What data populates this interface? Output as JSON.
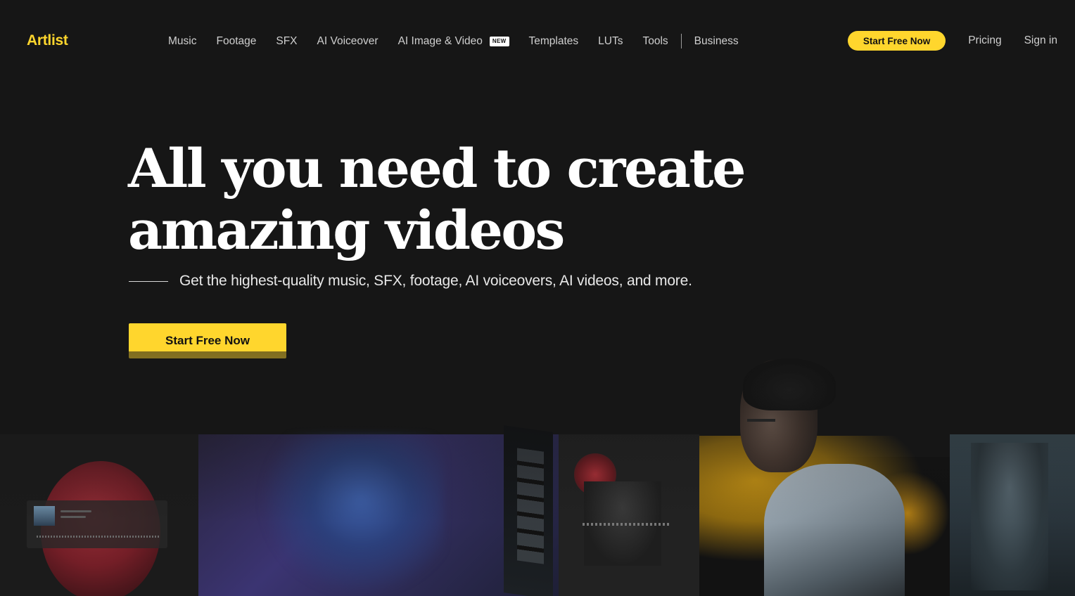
{
  "brand": {
    "logo_text": "Artlist",
    "accent_color": "#ffd62d",
    "background_color": "#161616"
  },
  "nav": {
    "links": [
      {
        "label": "Music"
      },
      {
        "label": "Footage"
      },
      {
        "label": "SFX"
      },
      {
        "label": "AI Voiceover"
      },
      {
        "label": "AI Image & Video",
        "badge": "NEW"
      },
      {
        "label": "Templates"
      },
      {
        "label": "LUTs"
      },
      {
        "label": "Tools"
      },
      {
        "label": "Business"
      }
    ],
    "cta_label": "Start Free Now",
    "pricing_label": "Pricing",
    "signin_label": "Sign in"
  },
  "hero": {
    "title_line1": "All you need to create",
    "title_line2": "amazing videos",
    "subtitle": "Get the highest-quality music, SFX, footage, AI voiceovers, AI videos, and more.",
    "cta_label": "Start Free Now"
  }
}
